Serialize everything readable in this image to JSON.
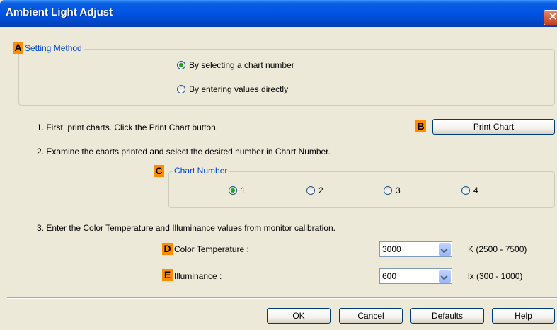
{
  "window": {
    "title": "Ambient Light Adjust"
  },
  "badges": {
    "a": "A",
    "b": "B",
    "c": "C",
    "d": "D",
    "e": "E"
  },
  "setting_method": {
    "label": "Setting Method",
    "options": [
      {
        "label": "By selecting a chart number",
        "checked": true
      },
      {
        "label": "By entering values directly",
        "checked": false
      }
    ]
  },
  "steps": {
    "step1": "1. First, print charts. Click the Print Chart button.",
    "step2": "2. Examine the charts printed and select the desired number in Chart Number.",
    "step3": "3. Enter the Color Temperature and Illuminance values from monitor calibration."
  },
  "print_chart_label": "Print Chart",
  "chart_number": {
    "label": "Chart Number",
    "options": [
      {
        "label": "1",
        "checked": true
      },
      {
        "label": "2",
        "checked": false
      },
      {
        "label": "3",
        "checked": false
      },
      {
        "label": "4",
        "checked": false
      }
    ]
  },
  "color_temperature": {
    "label": "Color Temperature :",
    "value": "3000",
    "range": "K (2500 - 7500)"
  },
  "illuminance": {
    "label": "Illuminance :",
    "value": "600",
    "range": "lx (300 - 1000)"
  },
  "buttons": {
    "ok": "OK",
    "cancel": "Cancel",
    "defaults": "Defaults",
    "help": "Help"
  },
  "colors": {
    "titlebar": "#0055e5",
    "badge": "#ff8c00",
    "group_label": "#0046d5",
    "radio_dot": "#21a121"
  },
  "icons": {
    "close": "close-icon"
  }
}
